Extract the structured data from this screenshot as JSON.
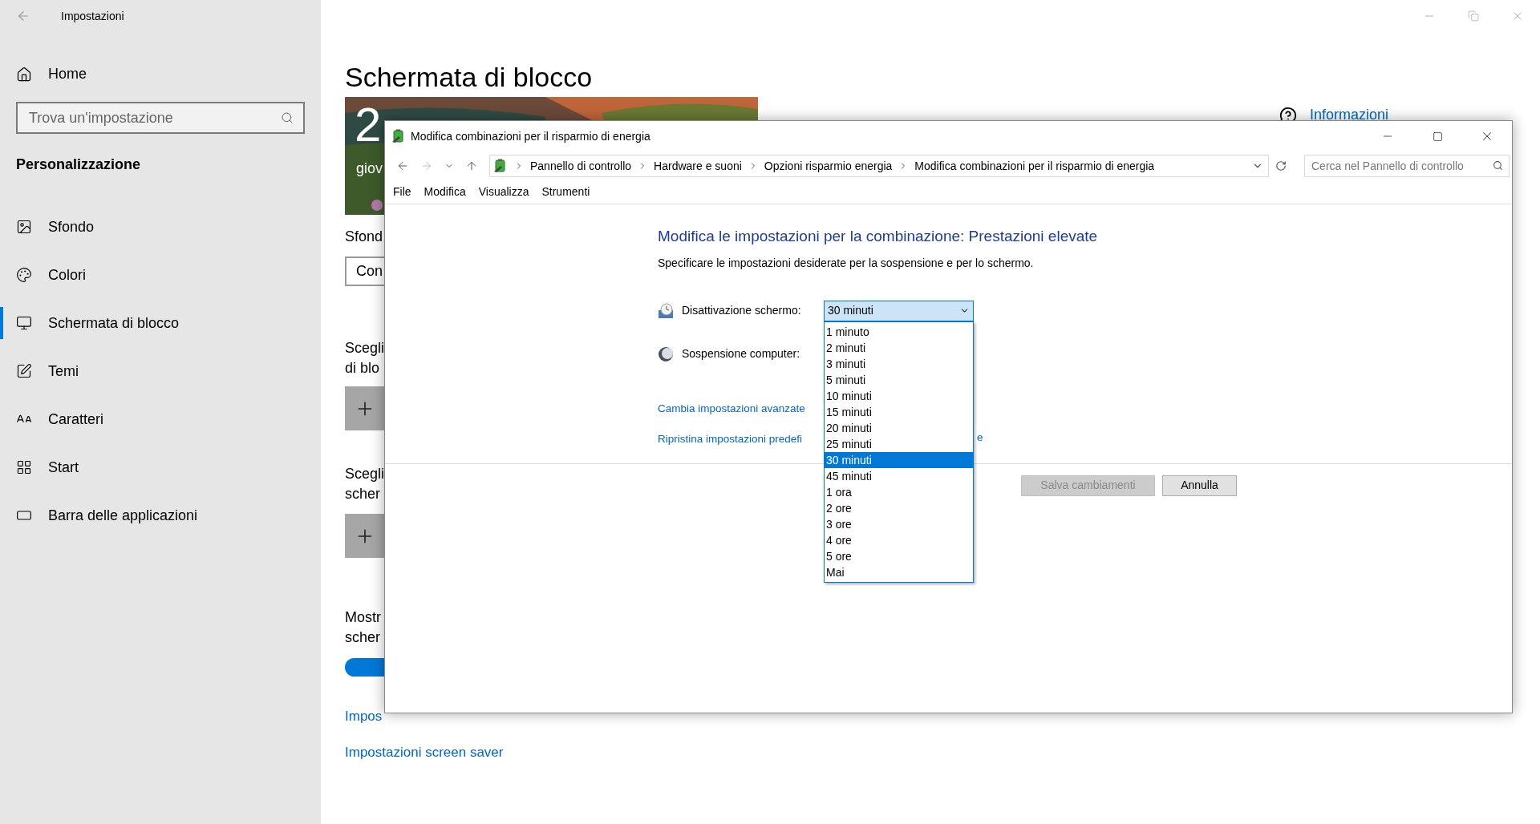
{
  "settings_window": {
    "title": "Impostazioni",
    "home": "Home",
    "search": {
      "placeholder": "Trova un'impostazione"
    },
    "section": "Personalizzazione",
    "nav": [
      {
        "label": "Sfondo",
        "selected": false
      },
      {
        "label": "Colori",
        "selected": false
      },
      {
        "label": "Schermata di blocco",
        "selected": true
      },
      {
        "label": "Temi",
        "selected": false
      },
      {
        "label": "Caratteri",
        "selected": false
      },
      {
        "label": "Start",
        "selected": false
      },
      {
        "label": "Barra delle applicazioni",
        "selected": false
      }
    ],
    "page_title": "Schermata di blocco",
    "preview": {
      "kind": "picture",
      "clock": "2",
      "date": "giov"
    },
    "help_link": "Informazioni",
    "content": [
      {
        "kind": "label",
        "lines": [
          "Sfond"
        ]
      },
      {
        "kind": "button",
        "text": "Con"
      },
      {
        "kind": "label",
        "lines": [
          "Scegli",
          "di blo"
        ]
      },
      {
        "kind": "add_button"
      },
      {
        "kind": "label",
        "lines": [
          "Scegli",
          "scher"
        ]
      },
      {
        "kind": "add_button"
      },
      {
        "kind": "label",
        "lines": [
          "Mostr",
          "scher"
        ]
      },
      {
        "kind": "toggle",
        "on": true
      },
      {
        "kind": "link",
        "text": "Impos"
      },
      {
        "kind": "link",
        "text": "Impostazioni screen saver"
      }
    ]
  },
  "dialog": {
    "title": "Modifica combinazioni per il risparmio di energia",
    "breadcrumbs": [
      "Pannello di controllo",
      "Hardware e suoni",
      "Opzioni risparmio energia",
      "Modifica combinazioni per il risparmio di energia"
    ],
    "search": {
      "placeholder": "Cerca nel Pannello di controllo"
    },
    "menu": [
      "File",
      "Modifica",
      "Visualizza",
      "Strumenti"
    ],
    "heading": "Modifica le impostazioni per la combinazione: Prestazioni elevate",
    "subtitle": "Specificare le impostazioni desiderate per la sospensione e per lo schermo.",
    "screen_off": {
      "label": "Disattivazione schermo:",
      "value": "30 minuti",
      "expanded": true,
      "options": [
        {
          "label": "1 minuto",
          "selected": false
        },
        {
          "label": "2 minuti",
          "selected": false
        },
        {
          "label": "3 minuti",
          "selected": false
        },
        {
          "label": "5 minuti",
          "selected": false
        },
        {
          "label": "10 minuti",
          "selected": false
        },
        {
          "label": "15 minuti",
          "selected": false
        },
        {
          "label": "20 minuti",
          "selected": false
        },
        {
          "label": "25 minuti",
          "selected": false
        },
        {
          "label": "30 minuti",
          "selected": true
        },
        {
          "label": "45 minuti",
          "selected": false
        },
        {
          "label": "1 ora",
          "selected": false
        },
        {
          "label": "2 ore",
          "selected": false
        },
        {
          "label": "3 ore",
          "selected": false
        },
        {
          "label": "4 ore",
          "selected": false
        },
        {
          "label": "5 ore",
          "selected": false
        },
        {
          "label": "Mai",
          "selected": false
        }
      ]
    },
    "sleep": {
      "label": "Sospensione computer:"
    },
    "links": [
      {
        "text": "Cambia impostazioni avanzate"
      },
      {
        "text": "Ripristina impostazioni predefi",
        "tail": "e"
      }
    ],
    "buttons": [
      {
        "label": "Salva cambiamenti",
        "disabled": true
      },
      {
        "label": "Annulla",
        "disabled": false
      }
    ]
  }
}
